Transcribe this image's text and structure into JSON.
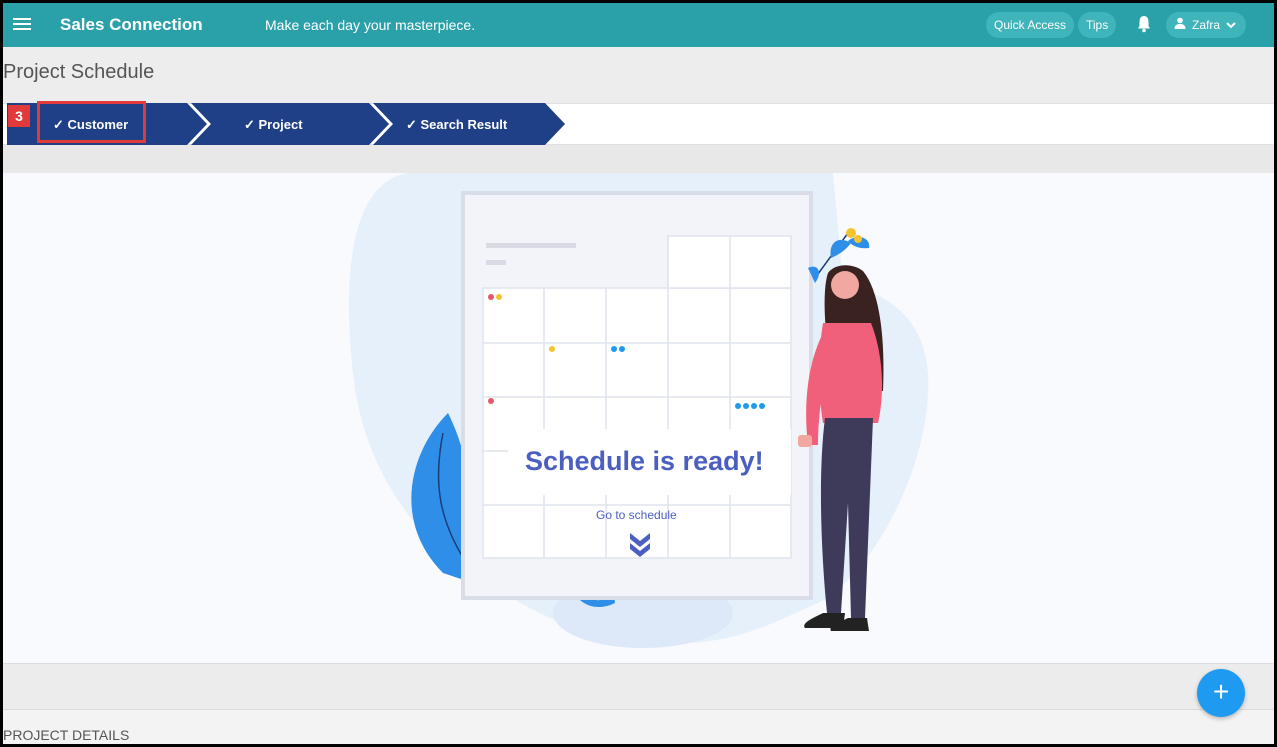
{
  "header": {
    "app_title": "Sales Connection",
    "tagline": "Make each day your masterpiece.",
    "quick_access": "Quick Access",
    "tips": "Tips",
    "user_name": "Zafra"
  },
  "page": {
    "title": "Project Schedule"
  },
  "stepper": {
    "badge": "3",
    "steps": [
      {
        "label": "✓ Customer",
        "active": true
      },
      {
        "label": "✓ Project",
        "active": false
      },
      {
        "label": "✓ Search Result",
        "active": false
      }
    ]
  },
  "hero": {
    "heading": "Schedule is ready!",
    "link": "Go to schedule"
  },
  "section": {
    "details_title": "PROJECT DETAILS"
  },
  "fab": {
    "label": "+"
  },
  "colors": {
    "topbar": "#2aa0a8",
    "step": "#1f3f86",
    "accent": "#4a5fc0",
    "highlight": "#e03a3a",
    "fab": "#1e9bf0"
  }
}
